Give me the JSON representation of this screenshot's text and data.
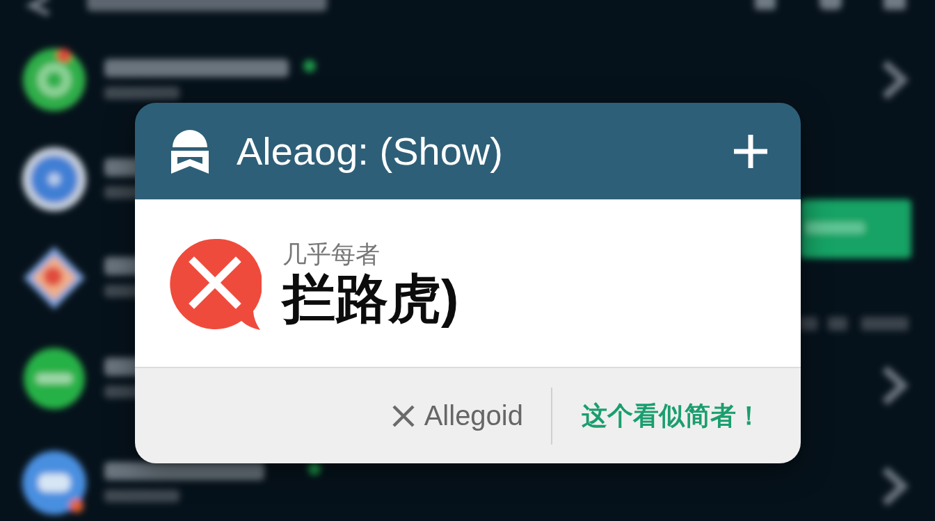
{
  "dialog": {
    "title": "Aleaog: (Show)",
    "message": {
      "subtitle": "几乎每者",
      "text": "拦路虎)"
    },
    "buttons": [
      {
        "label": "Allegoid",
        "kind": "dismiss"
      },
      {
        "label": "这个看似简者！",
        "kind": "confirm"
      }
    ]
  }
}
